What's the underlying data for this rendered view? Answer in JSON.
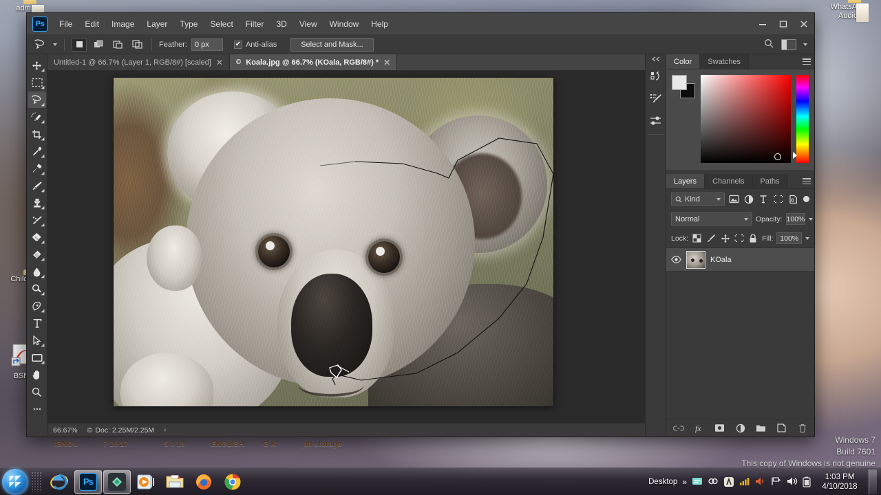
{
  "desktop": {
    "icons": [
      {
        "name": "adm",
        "label": "adm",
        "type": "folder"
      },
      {
        "name": "child",
        "label": "Child ...",
        "type": "folder"
      },
      {
        "name": "bsnl",
        "label": "BSNL",
        "type": "shortcut"
      },
      {
        "name": "whatsapp-audio",
        "label": "WhatsApp\nAudio",
        "type": "folder"
      }
    ],
    "background_text": [
      "IGNOU",
      "7 10 17",
      "5 4 18",
      "ENGLISH",
      "G K",
      "ph storage"
    ],
    "watermark": {
      "line1": "Windows 7",
      "line2": "Build 7601",
      "line3": "This copy of Windows is not genuine"
    }
  },
  "taskbar": {
    "start_label": "Start",
    "buttons": [
      {
        "name": "internet-explorer",
        "label": "Internet Explorer",
        "active": false
      },
      {
        "name": "photoshop",
        "label": "Adobe Photoshop",
        "active": true
      },
      {
        "name": "app-green",
        "label": "Application",
        "active": true
      },
      {
        "name": "media-player",
        "label": "Windows Media Player",
        "active": false
      },
      {
        "name": "file-explorer",
        "label": "Windows Explorer",
        "active": false
      },
      {
        "name": "firefox",
        "label": "Mozilla Firefox",
        "active": false
      },
      {
        "name": "chrome",
        "label": "Google Chrome",
        "active": false
      }
    ],
    "tray": {
      "desktop_label": "Desktop",
      "overflow": "»",
      "time": "1:03 PM",
      "date": "4/10/2018"
    }
  },
  "photoshop": {
    "logo": "Ps",
    "menus": [
      "File",
      "Edit",
      "Image",
      "Layer",
      "Type",
      "Select",
      "Filter",
      "3D",
      "View",
      "Window",
      "Help"
    ],
    "window_controls": {
      "minimize": "–",
      "maximize": "□",
      "close": "✕"
    },
    "options_bar": {
      "tool_icon": "lasso-icon",
      "selection_modes": [
        "new-selection",
        "add-to-selection",
        "subtract-from-selection",
        "intersect-selection"
      ],
      "active_selection_mode": 0,
      "feather_label": "Feather:",
      "feather_value": "0 px",
      "antialias_label": "Anti-alias",
      "antialias_checked": true,
      "select_and_mask_label": "Select and Mask...",
      "search_icon": "search-icon",
      "workspace_icon": "workspace-icon"
    },
    "tools": [
      {
        "name": "move-tool",
        "label": "Move Tool",
        "selected": false
      },
      {
        "name": "marquee-tool",
        "label": "Rectangular Marquee Tool",
        "selected": false
      },
      {
        "name": "lasso-tool",
        "label": "Polygonal Lasso Tool",
        "selected": true
      },
      {
        "name": "quick-selection-tool",
        "label": "Quick Selection Tool",
        "selected": false
      },
      {
        "name": "crop-tool",
        "label": "Crop Tool",
        "selected": false
      },
      {
        "name": "eyedropper-tool",
        "label": "Eyedropper Tool",
        "selected": false
      },
      {
        "name": "healing-brush-tool",
        "label": "Spot Healing Brush Tool",
        "selected": false
      },
      {
        "name": "brush-tool",
        "label": "Brush Tool",
        "selected": false
      },
      {
        "name": "clone-stamp-tool",
        "label": "Clone Stamp Tool",
        "selected": false
      },
      {
        "name": "history-brush-tool",
        "label": "History Brush Tool",
        "selected": false
      },
      {
        "name": "eraser-tool",
        "label": "Eraser Tool",
        "selected": false
      },
      {
        "name": "gradient-tool",
        "label": "Gradient Tool",
        "selected": false
      },
      {
        "name": "blur-tool",
        "label": "Blur Tool",
        "selected": false
      },
      {
        "name": "dodge-tool",
        "label": "Dodge Tool",
        "selected": false
      },
      {
        "name": "pen-tool",
        "label": "Pen Tool",
        "selected": false
      },
      {
        "name": "type-tool",
        "label": "Horizontal Type Tool",
        "selected": false
      },
      {
        "name": "path-selection-tool",
        "label": "Path Selection Tool",
        "selected": false
      },
      {
        "name": "shape-tool",
        "label": "Rectangle Tool",
        "selected": false
      },
      {
        "name": "hand-tool",
        "label": "Hand Tool",
        "selected": false
      },
      {
        "name": "zoom-tool",
        "label": "Zoom Tool",
        "selected": false
      }
    ],
    "tabs": [
      {
        "name": "untitled-1",
        "label": "Untitled-1 @ 66.7% (Layer 1, RGB/8#) [scaled]",
        "active": false,
        "modified": false,
        "close": "✕"
      },
      {
        "name": "koala-jpg",
        "label": "Koala.jpg @ 66.7% (KOala, RGB/8#) *",
        "active": true,
        "modified": true,
        "close": "✕",
        "profile_mark": "©"
      }
    ],
    "status_bar": {
      "zoom": "66.67%",
      "doc_icon": "©",
      "doc_label": "Doc: 2.25M/2.25M",
      "expand_arrow": "›"
    },
    "dock_rail": [
      {
        "name": "history-panel-icon",
        "label": "History"
      },
      {
        "name": "brush-presets-panel-icon",
        "label": "Brush Presets"
      },
      {
        "name": "adjustments-panel-icon",
        "label": "Adjustments"
      }
    ],
    "color_panel": {
      "tabs": [
        {
          "name": "color",
          "label": "Color",
          "active": true
        },
        {
          "name": "swatches",
          "label": "Swatches",
          "active": false
        }
      ],
      "foreground_color": "#e8e8e8",
      "background_color": "#0d0d0d",
      "field_base_hue": "#ff0000"
    },
    "layers_panel": {
      "tabs": [
        {
          "name": "layers",
          "label": "Layers",
          "active": true
        },
        {
          "name": "channels",
          "label": "Channels",
          "active": false
        },
        {
          "name": "paths",
          "label": "Paths",
          "active": false
        }
      ],
      "filter_label": "Kind",
      "filter_icons": [
        "pixel-filter-icon",
        "adjustment-filter-icon",
        "type-filter-icon",
        "shape-filter-icon",
        "smart-object-filter-icon"
      ],
      "blend_mode": "Normal",
      "opacity_label": "Opacity:",
      "opacity_value": "100%",
      "lock_label": "Lock:",
      "lock_icons": [
        "lock-transparency-icon",
        "lock-image-icon",
        "lock-position-icon",
        "lock-artboard-icon",
        "lock-all-icon"
      ],
      "fill_label": "Fill:",
      "fill_value": "100%",
      "layers": [
        {
          "name": "layer-koala",
          "label": "KOala",
          "visible": true,
          "selected": true,
          "visibility_icon": "eye-icon"
        }
      ],
      "footer_icons": [
        {
          "name": "link-layers-icon",
          "label": "Link layers"
        },
        {
          "name": "layer-style-icon",
          "label": "Add a layer style"
        },
        {
          "name": "layer-mask-icon",
          "label": "Add layer mask"
        },
        {
          "name": "adjustment-layer-icon",
          "label": "Create new fill or adjustment layer"
        },
        {
          "name": "new-group-icon",
          "label": "Create a new group"
        },
        {
          "name": "new-layer-icon",
          "label": "Create a new layer"
        },
        {
          "name": "delete-layer-icon",
          "label": "Delete layer"
        }
      ]
    },
    "canvas": {
      "document": "Koala.jpg",
      "zoom": "66.7%",
      "selection_active": true,
      "cursor": "polygonal-lasso-cursor"
    }
  }
}
